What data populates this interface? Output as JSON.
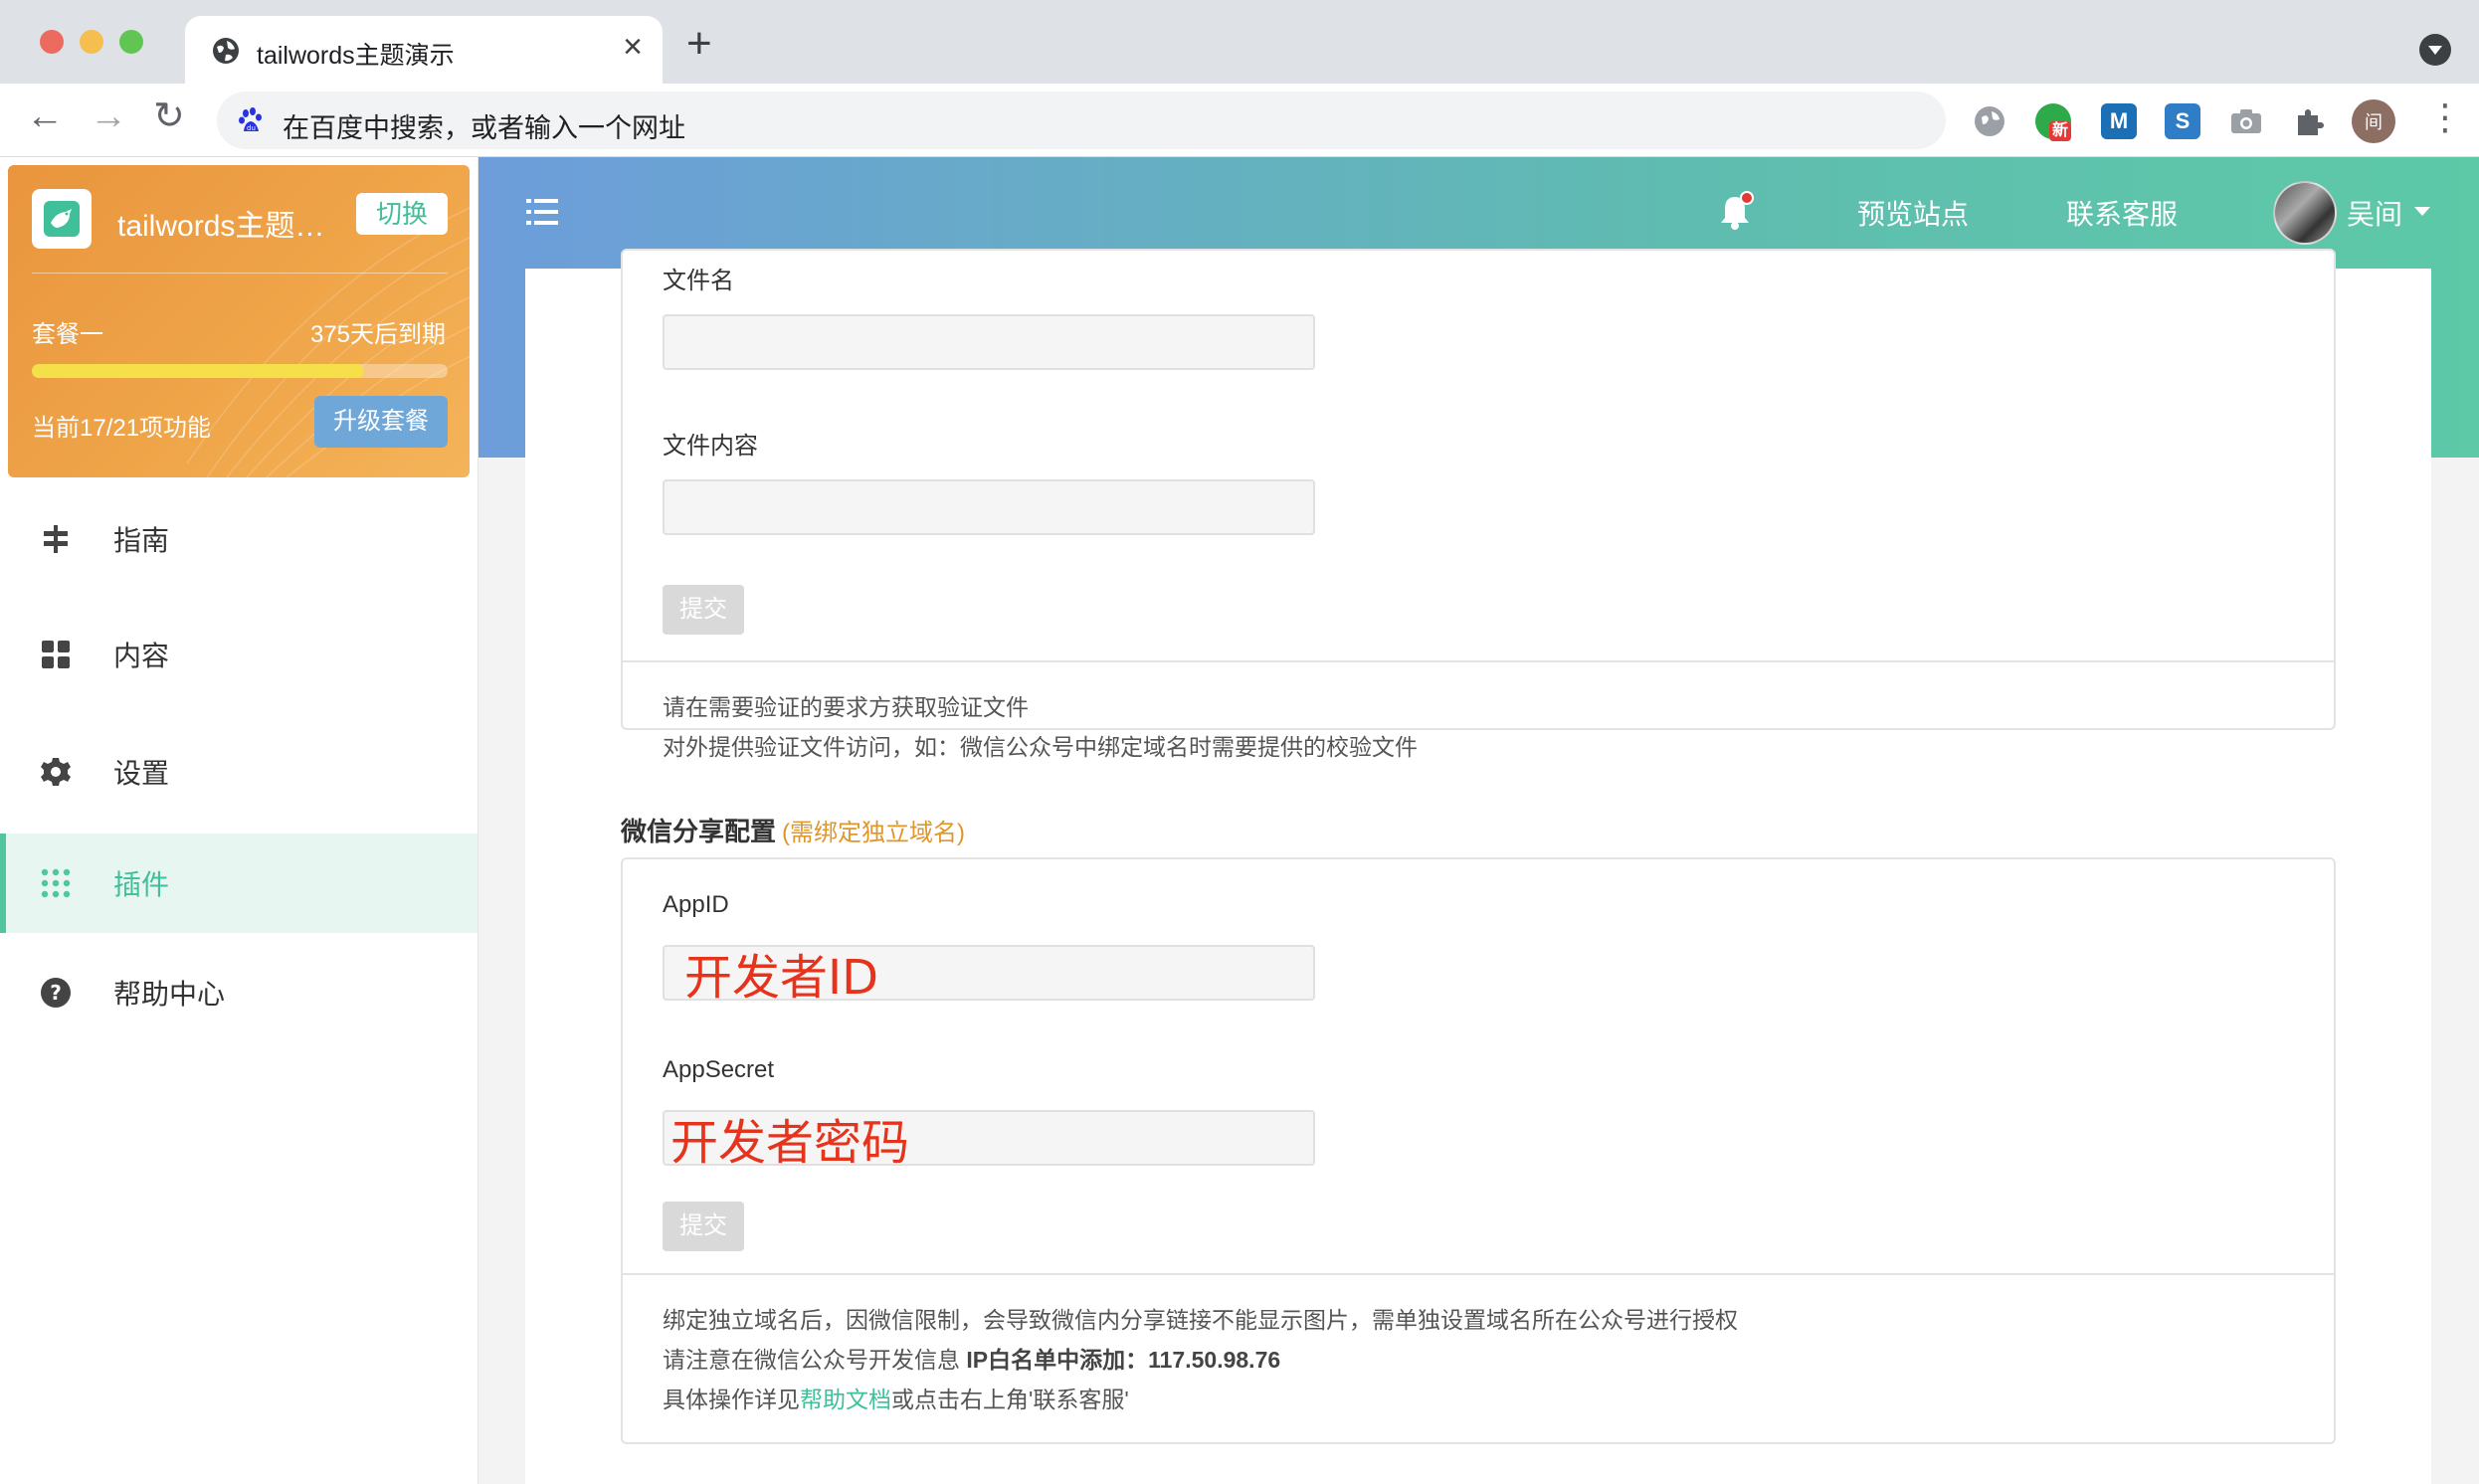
{
  "browser": {
    "tab_title": "tailwords主题演示",
    "close_glyph": "×",
    "new_tab_glyph": "+",
    "omnibox_placeholder": "在百度中搜索，或者输入一个网址",
    "extension_badge": "新",
    "extension_m": "M",
    "extension_s": "S",
    "profile_initial": "间",
    "back_glyph": "←",
    "forward_glyph": "→",
    "reload_glyph": "↻",
    "kebab_glyph": "⋮"
  },
  "sidebar": {
    "site_name": "tailwords主题演示",
    "switch_label": "切换",
    "plan_name": "套餐一",
    "plan_expire": "375天后到期",
    "plan_progress": 0.8,
    "feature_count": "当前17/21项功能",
    "upgrade_label": "升级套餐",
    "items": [
      {
        "label": "指南",
        "icon": "signpost-icon"
      },
      {
        "label": "内容",
        "icon": "grid-icon"
      },
      {
        "label": "设置",
        "icon": "gear-icon"
      },
      {
        "label": "插件",
        "icon": "dots-grid-icon",
        "active": true
      },
      {
        "label": "帮助中心",
        "icon": "help-circle-icon"
      }
    ]
  },
  "header": {
    "preview_site": "预览站点",
    "contact_support": "联系客服",
    "user_name": "吴间"
  },
  "verify_file": {
    "filename_label": "文件名",
    "content_label": "文件内容",
    "submit_label": "提交",
    "note_line1": "请在需要验证的要求方获取验证文件",
    "note_line2": "对外提供验证文件访问，如：微信公众号中绑定域名时需要提供的校验文件"
  },
  "wechat_share": {
    "title": "微信分享配置",
    "subtitle": "(需绑定独立域名)",
    "appid_label": "AppID",
    "appid_value": "开发者ID",
    "appsecret_label": "AppSecret",
    "appsecret_value": "开发者密码",
    "submit_label": "提交",
    "note_line1": "绑定独立域名后，因微信限制，会导致微信内分享链接不能显示图片，需单独设置域名所在公众号进行授权",
    "note_line2_prefix": "请注意在微信公众号开发信息 ",
    "note_line2_bold": "IP白名单中添加：117.50.98.76",
    "note_line3_prefix": "具体操作详见",
    "note_line3_link": "帮助文档",
    "note_line3_suffix": "或点击右上角'联系客服'"
  },
  "colors": {
    "accent": "#3fbf9a",
    "plan_card": "#f0a64a",
    "header_start": "#6d9ddb",
    "header_end": "#5dc9a7",
    "annotation_red": "#e6331c"
  }
}
